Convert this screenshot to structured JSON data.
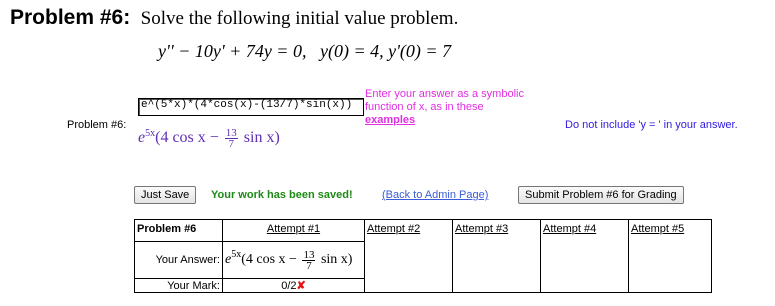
{
  "heading": {
    "problem_number": "Problem #6:",
    "statement": "Solve the following initial value problem."
  },
  "equation": {
    "lhs": "y'' − 10y' + 74y = 0,",
    "ic1": "y(0) = 4,",
    "ic2": "y'(0) = 7"
  },
  "side_label": "Problem #6:",
  "answer": {
    "input_value": "e^(5*x)*(4*cos(x)-(13/7)*sin(x))",
    "rendered_base": "e",
    "rendered_exp": "5x",
    "rendered_part1": "(4 cos x −",
    "frac_num": "13",
    "frac_den": "7",
    "rendered_part2": "sin x)"
  },
  "hint": {
    "line1": "Enter your answer as a symbolic",
    "line2": "function of x, as in these",
    "link": "examples"
  },
  "note": "Do not include 'y = ' in your answer.",
  "actions": {
    "just_save": "Just Save",
    "saved_message": "Your work has been saved!",
    "admin_link": "(Back to Admin Page)",
    "submit": "Submit Problem #6 for Grading"
  },
  "table": {
    "header_label": "Problem #6",
    "attempts": [
      "Attempt #1",
      "Attempt #2",
      "Attempt #3",
      "Attempt #4",
      "Attempt #5"
    ],
    "your_answer_label": "Your Answer:",
    "your_mark_label": "Your Mark:",
    "mark_value": "0/2",
    "mark_symbol": "✘"
  }
}
